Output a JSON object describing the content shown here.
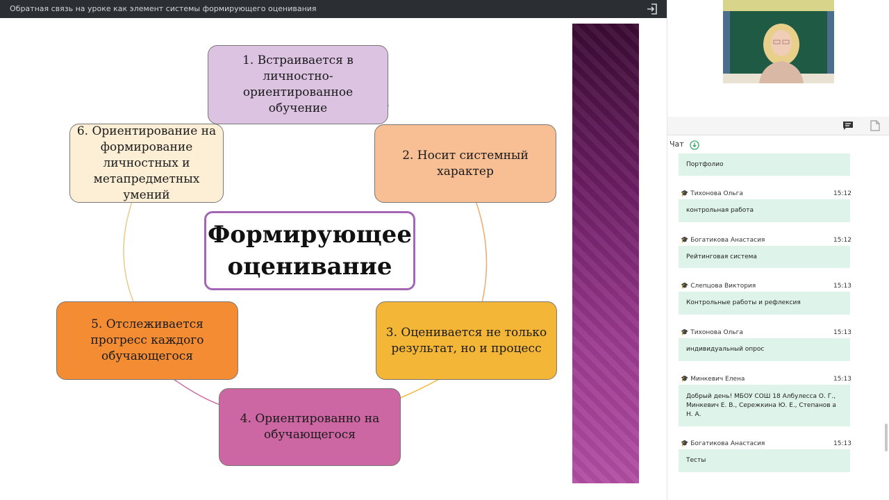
{
  "window": {
    "title": "Обратная связь на уроке как элемент системы формирующего оценивания"
  },
  "slide": {
    "center_title": "Формирующее оценивание",
    "boxes": [
      {
        "text": "1. Встраивается в личностно-ориентированное обучение",
        "color": "#dcc3e2"
      },
      {
        "text": "2. Носит системный характер",
        "color": "#f8bf94"
      },
      {
        "text": "3. Оценивается не только результат, но и процесс",
        "color": "#f4b636"
      },
      {
        "text": "4. Ориентированно на обучающегося",
        "color": "#cd67a3"
      },
      {
        "text": "5. Отслеживается прогресс каждого обучающегося",
        "color": "#f48c34"
      },
      {
        "text": "6. Ориентирование на формирование личностных и метапредметных умений",
        "color": "#fdefd6"
      }
    ]
  },
  "chat": {
    "label": "Чат",
    "messages": [
      {
        "author": "",
        "time": "",
        "text": "Портфолио"
      },
      {
        "author": "Тихонова Ольга",
        "time": "15:12",
        "text": "контрольная работа"
      },
      {
        "author": "Богатикова Анастасия",
        "time": "15:12",
        "text": "Рейтинговая система"
      },
      {
        "author": "Слепцова Виктория",
        "time": "15:13",
        "text": "Контрольные работы и рефлексия"
      },
      {
        "author": "Тихонова Ольга",
        "time": "15:13",
        "text": "индивидуальный опрос"
      },
      {
        "author": "Минкевич Елена",
        "time": "15:13",
        "text": "Добрый день! МБОУ СОШ 18 Албулесса О. Г., Минкевич Е. В., Сережкина Ю. Е., Степанов а Н. А."
      },
      {
        "author": "Богатикова Анастасия",
        "time": "15:13",
        "text": "Тесты"
      }
    ]
  },
  "icons": {
    "exit": "exit-icon",
    "chat_tab": "chat-bubble-icon",
    "files_tab": "document-icon",
    "download": "download-circle-icon",
    "author": "graduation-cap-icon"
  },
  "colors": {
    "topbar": "#2b2e33",
    "bubble": "#def3ea",
    "accent_green": "#3aa870",
    "center_border": "#a266b5"
  }
}
